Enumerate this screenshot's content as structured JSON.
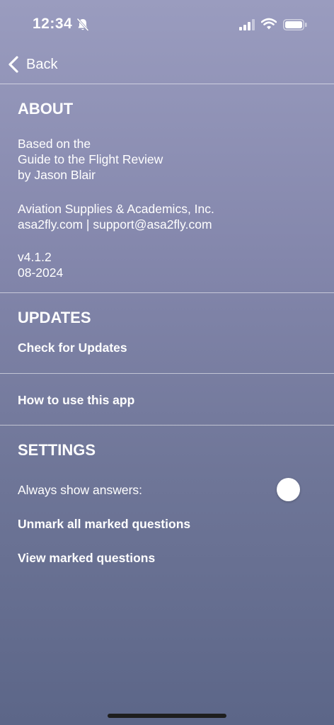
{
  "status": {
    "time": "12:34"
  },
  "nav": {
    "back_label": "Back"
  },
  "about": {
    "heading": "ABOUT",
    "based_on": [
      "Based on the",
      "Guide to the Flight Review",
      "by Jason Blair"
    ],
    "publisher": "Aviation Supplies & Academics, Inc.",
    "contact": "asa2fly.com | support@asa2fly.com",
    "version": "v4.1.2",
    "date": "08-2024"
  },
  "updates": {
    "heading": "UPDATES",
    "check_label": "Check for Updates"
  },
  "help": {
    "how_to_label": "How to use this app"
  },
  "settings": {
    "heading": "SETTINGS",
    "always_show_label": "Always show answers:",
    "always_show_value": false,
    "unmark_label": "Unmark all marked questions",
    "view_marked_label": "View marked questions"
  },
  "icons": [
    "bell-slash-icon",
    "cellular-signal-icon",
    "wifi-icon",
    "battery-icon",
    "chevron-left-icon"
  ]
}
